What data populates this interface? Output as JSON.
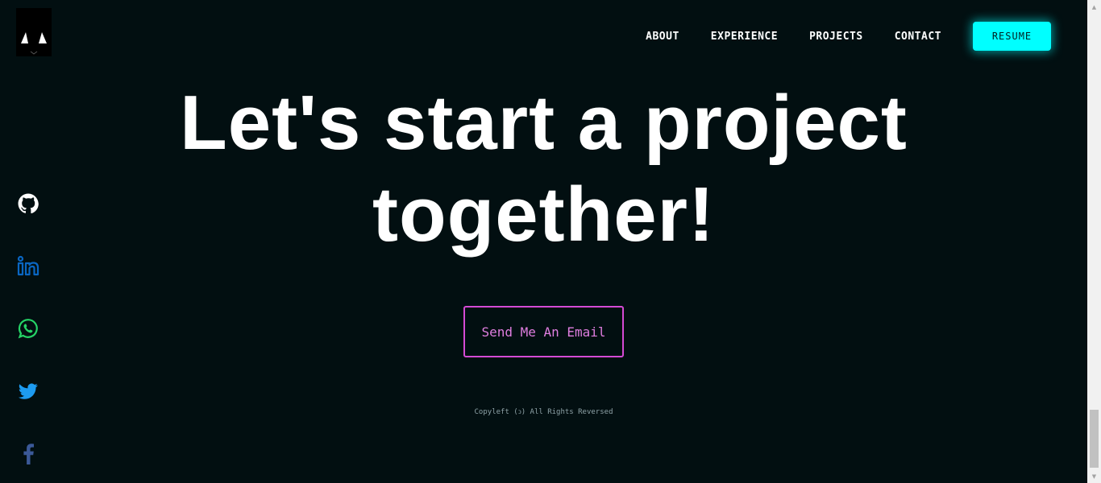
{
  "logo": {
    "icon": "cat-ears-logo-icon"
  },
  "nav": {
    "items": [
      {
        "label": "ABOUT"
      },
      {
        "label": "EXPERIENCE"
      },
      {
        "label": "PROJECTS"
      },
      {
        "label": "CONTACT"
      }
    ],
    "resume_label": "RESUME"
  },
  "socials": [
    {
      "icon": "github-icon",
      "color": "#ffffff"
    },
    {
      "icon": "linkedin-icon",
      "color": "#0a66c2"
    },
    {
      "icon": "whatsapp-icon",
      "color": "#25d366"
    },
    {
      "icon": "twitter-icon",
      "color": "#1d9bf0"
    },
    {
      "icon": "facebook-icon",
      "color": "#3b5998"
    }
  ],
  "hero": {
    "line1": "Let's start a project",
    "line2": "together!"
  },
  "cta": {
    "label": "Send Me An Email"
  },
  "footer": {
    "copyright": "Copyleft (ↄ) All Rights Reversed"
  },
  "colors": {
    "background": "#020f11",
    "accent_cyan": "#00ffff",
    "accent_magenta": "#d44ad4"
  }
}
